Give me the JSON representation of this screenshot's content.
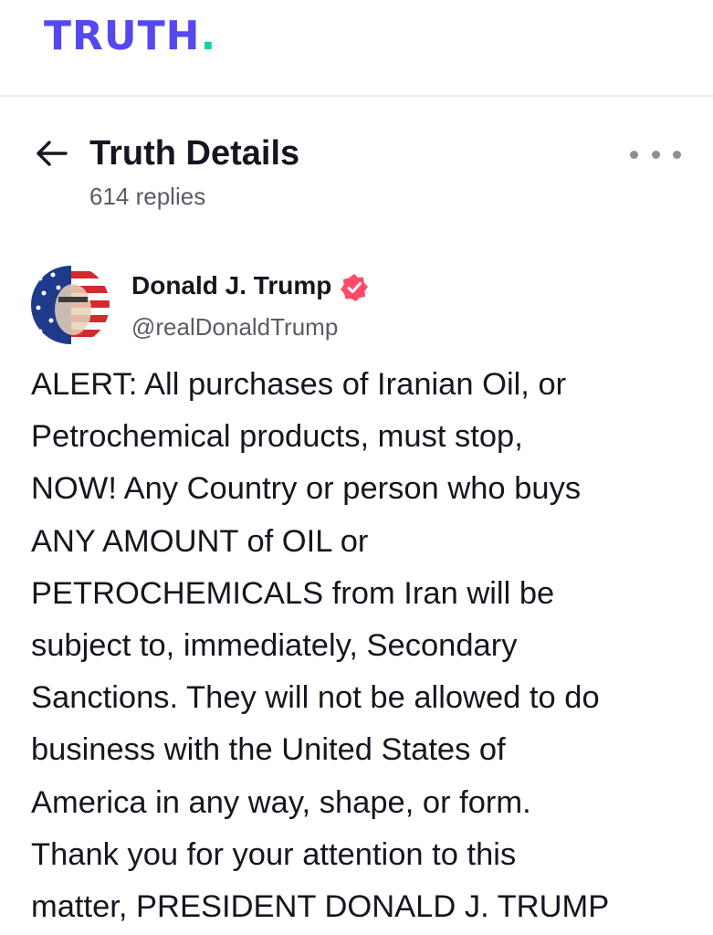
{
  "brand": {
    "logo_text": "TRUTH",
    "logo_dot": ".",
    "accent": "#5448ee",
    "dot_color": "#0bd3a5"
  },
  "header": {
    "back_icon": "arrow-left-icon",
    "title": "Truth Details",
    "replies": "614 replies",
    "more_icon": "more-horizontal-icon"
  },
  "post": {
    "author": {
      "name": "Donald J. Trump",
      "handle": "@realDonaldTrump",
      "verified": true,
      "verified_color": "#ff4b6a",
      "verified_icon": "verified-badge-icon"
    },
    "lines": [
      "ALERT: All purchases of Iranian Oil, or",
      "Petrochemical products, must stop,",
      "NOW! Any Country or person who buys",
      "ANY AMOUNT of OIL or",
      "PETROCHEMICALS from Iran will be",
      "subject to, immediately, Secondary",
      "Sanctions. They will not be allowed to do",
      "business with the United States of",
      "America in any way, shape, or form.",
      "Thank you for your attention to this",
      "matter, PRESIDENT DONALD J. TRUMP"
    ]
  }
}
